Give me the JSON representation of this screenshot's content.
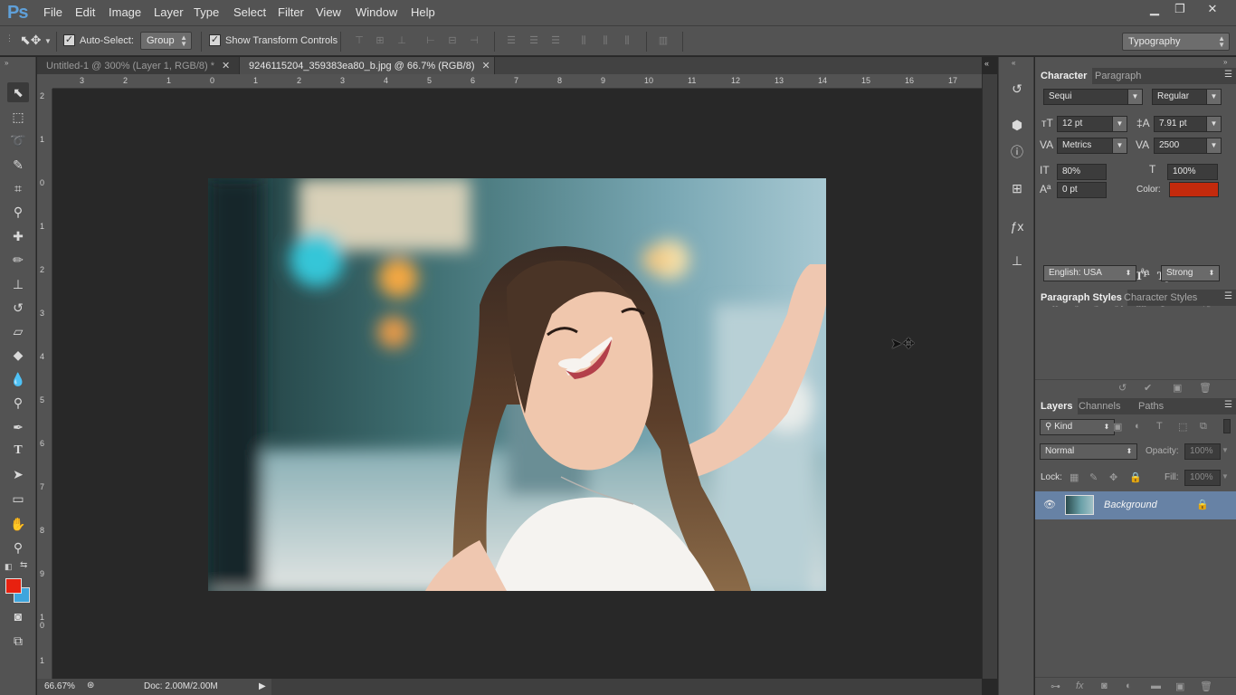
{
  "app": {
    "logo": "Ps"
  },
  "menu": [
    "File",
    "Edit",
    "Image",
    "Layer",
    "Type",
    "Select",
    "Filter",
    "View",
    "Window",
    "Help"
  ],
  "window_buttons": {
    "minimize": "▁",
    "restore": "❐",
    "close": "✕"
  },
  "options": {
    "auto_select_label": "Auto-Select:",
    "auto_select_checked": true,
    "auto_select_mode": "Group",
    "show_transform_label": "Show Transform Controls",
    "show_transform_checked": true,
    "workspace": "Typography"
  },
  "tabs": [
    {
      "label": "Untitled-1 @ 300% (Layer 1, RGB/8) *",
      "active": false
    },
    {
      "label": "9246115204_359383ea80_b.jpg @ 66.7% (RGB/8)",
      "active": true
    }
  ],
  "ruler": {
    "h_ticks": [
      "3",
      "2",
      "1",
      "0",
      "1",
      "2",
      "3",
      "4",
      "5",
      "6",
      "7",
      "8",
      "9",
      "10",
      "11",
      "12",
      "13",
      "14",
      "15",
      "16",
      "17"
    ],
    "v_ticks": [
      "2",
      "1",
      "0",
      "1",
      "2",
      "3",
      "4",
      "5",
      "6",
      "7",
      "8",
      "9",
      "1\n0",
      "1"
    ]
  },
  "status": {
    "zoom": "66.67%",
    "doc": "Doc: 2.00M/2.00M"
  },
  "character": {
    "tabs": [
      "Character",
      "Paragraph"
    ],
    "font_family": "Sequi",
    "font_style": "Regular",
    "font_size": "12 pt",
    "leading": "7.91 pt",
    "kerning": "Metrics",
    "tracking": "2500",
    "vertical_scale": "80%",
    "horizontal_scale": "100%",
    "baseline_shift": "0 pt",
    "color_label": "Color:",
    "color": "#c42a0c",
    "language": "English: USA",
    "antialias": "Strong",
    "aa_label": "ªa"
  },
  "styles_panel": {
    "tabs": [
      "Paragraph Styles",
      "Character Styles"
    ]
  },
  "layers_panel": {
    "tabs": [
      "Layers",
      "Channels",
      "Paths"
    ],
    "filter": "Kind",
    "blend_mode": "Normal",
    "opacity_label": "Opacity:",
    "opacity": "100%",
    "lock_label": "Lock:",
    "fill_label": "Fill:",
    "fill": "100%",
    "layers": [
      {
        "name": "Background",
        "visible": true,
        "locked": true
      }
    ]
  },
  "colors": {
    "foreground": "#e8210f",
    "background": "#3ea5dd",
    "accent": "#5fa0d9"
  }
}
